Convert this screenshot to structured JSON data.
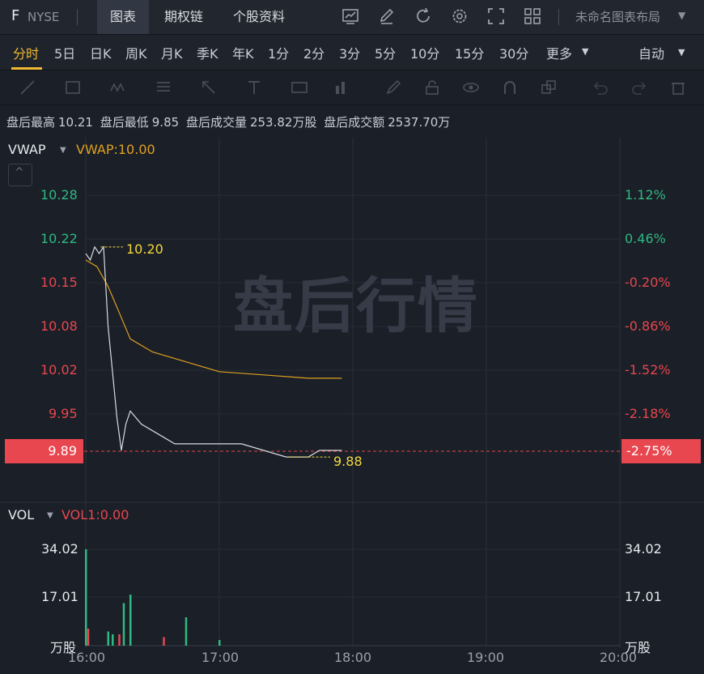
{
  "topbar": {
    "ticker": "F",
    "exchange": "NYSE",
    "tabs": [
      "图表",
      "期权链",
      "个股资料"
    ],
    "active_tab": "图表",
    "layout_title": "未命名图表布局",
    "icons": [
      "chart-icon",
      "edit-icon",
      "refresh-icon",
      "settings-icon",
      "fullscreen-icon",
      "grid-layout-icon"
    ]
  },
  "periods": {
    "items": [
      "分时",
      "5日",
      "日K",
      "周K",
      "月K",
      "季K",
      "年K",
      "1分",
      "2分",
      "3分",
      "5分",
      "10分",
      "15分",
      "30分",
      "更多"
    ],
    "active": "分时",
    "scale_mode": "自动"
  },
  "drawing_tools": [
    "line-tool-icon",
    "rectangle-tool-icon",
    "wave-tool-icon",
    "fib-tool-icon",
    "arrow-tool-icon",
    "text-tool-icon",
    "note-tool-icon",
    "bar-tool-icon",
    "brush-icon",
    "lock-icon",
    "eye-icon",
    "magnet-icon",
    "layers-icon",
    "undo-icon",
    "redo-icon",
    "trash-icon"
  ],
  "info": {
    "high_label": "盘后最高",
    "high": "10.21",
    "low_label": "盘后最低",
    "low": "9.85",
    "vol_label": "盘后成交量",
    "vol": "253.82万股",
    "amt_label": "盘后成交额",
    "amt": "2537.70万"
  },
  "price_panel": {
    "indicator": "VWAP",
    "indicator_value": "VWAP:10.00",
    "left_ticks": [
      "10.28",
      "10.22",
      "10.15",
      "10.08",
      "10.02",
      "9.95"
    ],
    "right_ticks": [
      "1.12%",
      "0.46%",
      "-0.20%",
      "-0.86%",
      "-1.52%",
      "-2.18%"
    ],
    "current_price": "9.89",
    "current_pct": "-2.75%",
    "high_marker": "10.20",
    "low_marker": "9.88",
    "watermark": "盘后行情"
  },
  "volume_panel": {
    "indicator": "VOL",
    "indicator_value": "VOL1:0.00",
    "left_ticks": [
      "34.02",
      "17.01"
    ],
    "right_ticks": [
      "34.02",
      "17.01"
    ],
    "unit": "万股"
  },
  "time_axis": [
    "16:00",
    "17:00",
    "18:00",
    "19:00",
    "20:00"
  ],
  "colors": {
    "up": "#2fb980",
    "down": "#e8474f",
    "vwap": "#e0a020",
    "price_line": "#d8dce2",
    "accent": "#f0b830"
  },
  "chart_data": [
    {
      "type": "line",
      "series": [
        {
          "name": "price",
          "x": [
            "16:00",
            "16:02",
            "16:04",
            "16:06",
            "16:08",
            "16:10",
            "16:12",
            "16:14",
            "16:16",
            "16:18",
            "16:20",
            "16:25",
            "16:30",
            "16:35",
            "16:40",
            "16:45",
            "16:50",
            "17:00",
            "17:10",
            "17:20",
            "17:30",
            "17:40",
            "17:45",
            "17:50",
            "17:55"
          ],
          "values": [
            10.19,
            10.18,
            10.2,
            10.19,
            10.2,
            10.08,
            10.01,
            9.94,
            9.89,
            9.93,
            9.95,
            9.93,
            9.92,
            9.91,
            9.9,
            9.9,
            9.9,
            9.9,
            9.9,
            9.89,
            9.88,
            9.88,
            9.89,
            9.89,
            9.89
          ]
        },
        {
          "name": "VWAP",
          "x": [
            "16:00",
            "16:05",
            "16:10",
            "16:15",
            "16:20",
            "16:30",
            "16:40",
            "16:50",
            "17:00",
            "17:20",
            "17:40",
            "17:55"
          ],
          "values": [
            10.18,
            10.17,
            10.14,
            10.1,
            10.06,
            10.04,
            10.03,
            10.02,
            10.01,
            10.005,
            10.0,
            10.0
          ]
        }
      ],
      "ylim": [
        9.89,
        10.28
      ]
    },
    {
      "type": "bar",
      "series": [
        {
          "name": "volume",
          "x": [
            "16:00",
            "16:01",
            "16:10",
            "16:12",
            "16:15",
            "16:17",
            "16:20",
            "16:35",
            "16:45",
            "17:00"
          ],
          "values": [
            34.02,
            6,
            5,
            4,
            4,
            15,
            18,
            3,
            10,
            2
          ]
        }
      ],
      "ylim": [
        0,
        34.02
      ]
    }
  ]
}
